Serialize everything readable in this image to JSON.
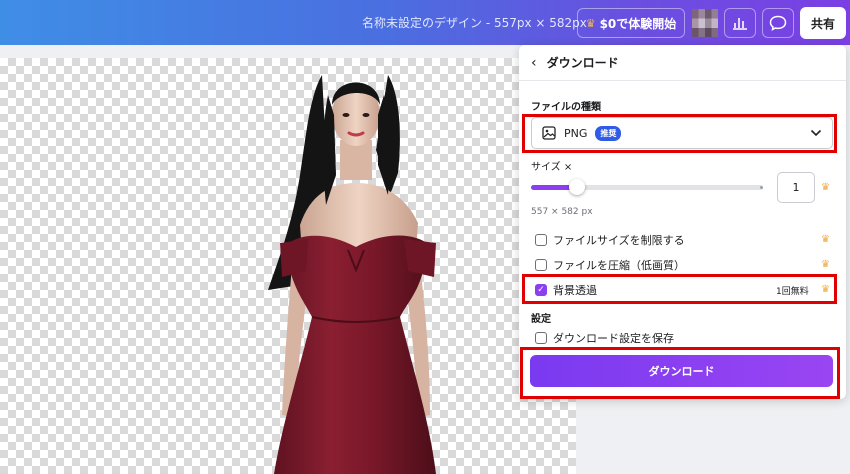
{
  "topbar": {
    "design_title": "名称未設定のデザイン - 557px × 582px",
    "trial_button": "$0で体験開始",
    "share_button": "共有"
  },
  "panel": {
    "title": "ダウンロード",
    "file_type_label": "ファイルの種類",
    "file_type_value": "PNG",
    "recommended_badge": "推奨",
    "size_label": "サイズ ×",
    "size_value": "1",
    "size_slider_value": 0.2,
    "dimensions": "557 × 582 px",
    "options": [
      {
        "label": "ファイルサイズを制限する",
        "checked": false
      },
      {
        "label": "ファイルを圧縮（低画質）",
        "checked": false
      },
      {
        "label": "背景透過",
        "checked": true,
        "note": "1回無料"
      }
    ],
    "settings_label": "設定",
    "save_settings": {
      "label": "ダウンロード設定を保存",
      "checked": false
    },
    "download_button": "ダウンロード"
  },
  "colors": {
    "accent": "#8b3ff0",
    "highlight": "#e00000",
    "crown": "#f0a93b"
  }
}
